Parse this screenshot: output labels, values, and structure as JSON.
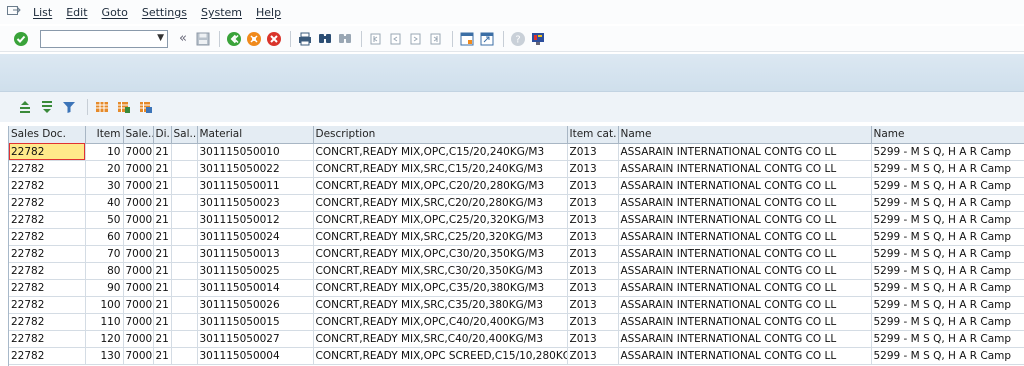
{
  "menu": {
    "items": [
      "List",
      "Edit",
      "Goto",
      "Settings",
      "System",
      "Help"
    ]
  },
  "toolbar": {
    "command_field_value": "",
    "icons": [
      "confirm-icon",
      "back-icon",
      "save-icon",
      "back-green-icon",
      "exit-icon",
      "cancel-icon",
      "print-icon",
      "find-icon",
      "find-next-icon",
      "first-page-icon",
      "previous-page-icon",
      "next-page-icon",
      "last-page-icon",
      "new-session-icon",
      "shortcut-icon",
      "help-icon",
      "customize-layout-icon"
    ]
  },
  "alv_toolbar": {
    "icons": [
      "sort-ascending-icon",
      "sort-descending-icon",
      "filter-icon",
      "change-layout-icon",
      "select-layout-icon",
      "save-layout-icon"
    ]
  },
  "title": "",
  "table": {
    "columns": [
      "Sales Doc.",
      "Item",
      "Sale..",
      "Di..",
      "Sal..",
      "Material",
      "Description",
      "Item cat.",
      "Name",
      "Name"
    ],
    "rows": [
      [
        "22782",
        "10",
        "7000",
        "21",
        "",
        "301115050010",
        "CONCRT,READY MIX,OPC,C15/20,240KG/M3",
        "Z013",
        "ASSARAIN INTERNATIONAL CONTG CO LL",
        "5299 - M S Q, H A R Camp"
      ],
      [
        "22782",
        "20",
        "7000",
        "21",
        "",
        "301115050022",
        "CONCRT,READY MIX,SRC,C15/20,240KG/M3",
        "Z013",
        "ASSARAIN INTERNATIONAL CONTG CO LL",
        "5299 - M S Q, H A R Camp"
      ],
      [
        "22782",
        "30",
        "7000",
        "21",
        "",
        "301115050011",
        "CONCRT,READY MIX,OPC,C20/20,280KG/M3",
        "Z013",
        "ASSARAIN INTERNATIONAL CONTG CO LL",
        "5299 - M S Q, H A R Camp"
      ],
      [
        "22782",
        "40",
        "7000",
        "21",
        "",
        "301115050023",
        "CONCRT,READY MIX,SRC,C20/20,280KG/M3",
        "Z013",
        "ASSARAIN INTERNATIONAL CONTG CO LL",
        "5299 - M S Q, H A R Camp"
      ],
      [
        "22782",
        "50",
        "7000",
        "21",
        "",
        "301115050012",
        "CONCRT,READY MIX,OPC,C25/20,320KG/M3",
        "Z013",
        "ASSARAIN INTERNATIONAL CONTG CO LL",
        "5299 - M S Q, H A R Camp"
      ],
      [
        "22782",
        "60",
        "7000",
        "21",
        "",
        "301115050024",
        "CONCRT,READY MIX,SRC,C25/20,320KG/M3",
        "Z013",
        "ASSARAIN INTERNATIONAL CONTG CO LL",
        "5299 - M S Q, H A R Camp"
      ],
      [
        "22782",
        "70",
        "7000",
        "21",
        "",
        "301115050013",
        "CONCRT,READY MIX,OPC,C30/20,350KG/M3",
        "Z013",
        "ASSARAIN INTERNATIONAL CONTG CO LL",
        "5299 - M S Q, H A R Camp"
      ],
      [
        "22782",
        "80",
        "7000",
        "21",
        "",
        "301115050025",
        "CONCRT,READY MIX,SRC,C30/20,350KG/M3",
        "Z013",
        "ASSARAIN INTERNATIONAL CONTG CO LL",
        "5299 - M S Q, H A R Camp"
      ],
      [
        "22782",
        "90",
        "7000",
        "21",
        "",
        "301115050014",
        "CONCRT,READY MIX,OPC,C35/20,380KG/M3",
        "Z013",
        "ASSARAIN INTERNATIONAL CONTG CO LL",
        "5299 - M S Q, H A R Camp"
      ],
      [
        "22782",
        "100",
        "7000",
        "21",
        "",
        "301115050026",
        "CONCRT,READY MIX,SRC,C35/20,380KG/M3",
        "Z013",
        "ASSARAIN INTERNATIONAL CONTG CO LL",
        "5299 - M S Q, H A R Camp"
      ],
      [
        "22782",
        "110",
        "7000",
        "21",
        "",
        "301115050015",
        "CONCRT,READY MIX,OPC,C40/20,400KG/M3",
        "Z013",
        "ASSARAIN INTERNATIONAL CONTG CO LL",
        "5299 - M S Q, H A R Camp"
      ],
      [
        "22782",
        "120",
        "7000",
        "21",
        "",
        "301115050027",
        "CONCRT,READY MIX,SRC,C40/20,400KG/M3",
        "Z013",
        "ASSARAIN INTERNATIONAL CONTG CO LL",
        "5299 - M S Q, H A R Camp"
      ],
      [
        "22782",
        "130",
        "7000",
        "21",
        "",
        "301115050004",
        "CONCRT,READY MIX,OPC SCREED,C15/10,280KG",
        "Z013",
        "ASSARAIN INTERNATIONAL CONTG CO LL",
        "5299 - M S Q, H A R Camp"
      ]
    ]
  },
  "colors": {
    "title_band": "#d5e3ef",
    "header_bg": "#e4ecf3",
    "selected_cell": "#ffe98a",
    "confirm_green": "#3aa33a",
    "exit_orange": "#f08a1c",
    "cancel_red": "#d9342b"
  }
}
